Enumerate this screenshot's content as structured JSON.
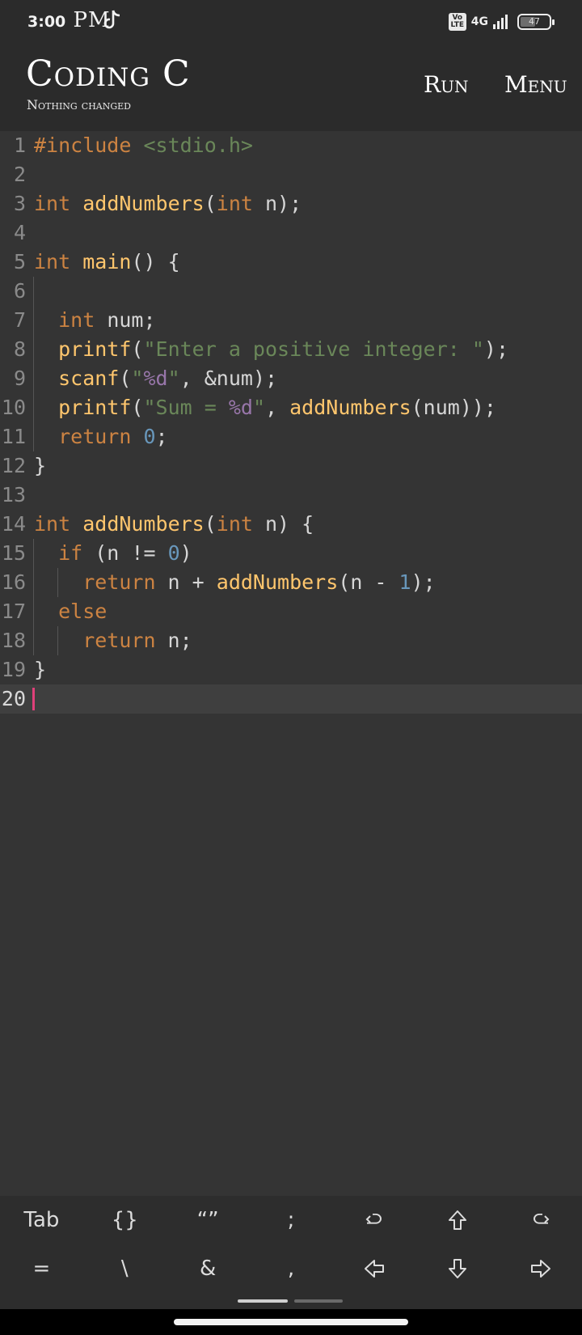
{
  "status_bar": {
    "time": "3:00",
    "ampm": "PM",
    "volte": "Vo LTE",
    "network": "4G",
    "battery": "47"
  },
  "app_bar": {
    "title": "Coding C",
    "subtitle": "Nothing changed",
    "run_label": "Run",
    "menu_label": "Menu"
  },
  "editor": {
    "active_line": 20,
    "lines": [
      {
        "n": "1",
        "indent": 0,
        "tokens": [
          [
            "kw",
            "#include "
          ],
          [
            "str",
            "<stdio.h>"
          ]
        ]
      },
      {
        "n": "2",
        "indent": 0,
        "tokens": []
      },
      {
        "n": "3",
        "indent": 0,
        "tokens": [
          [
            "kw",
            "int "
          ],
          [
            "fn",
            "addNumbers"
          ],
          [
            "p",
            "("
          ],
          [
            "kw",
            "int"
          ],
          [
            "p",
            " n);"
          ]
        ]
      },
      {
        "n": "4",
        "indent": 0,
        "tokens": []
      },
      {
        "n": "5",
        "indent": 0,
        "tokens": [
          [
            "kw",
            "int "
          ],
          [
            "fn",
            "main"
          ],
          [
            "p",
            "() {"
          ]
        ]
      },
      {
        "n": "6",
        "indent": 0,
        "guides": [
          1
        ],
        "tokens": []
      },
      {
        "n": "7",
        "indent": 1,
        "guides": [
          1
        ],
        "tokens": [
          [
            "kw",
            "int "
          ],
          [
            "p",
            "num;"
          ]
        ]
      },
      {
        "n": "8",
        "indent": 1,
        "guides": [
          1
        ],
        "tokens": [
          [
            "fn",
            "printf"
          ],
          [
            "p",
            "("
          ],
          [
            "str",
            "\"Enter a positive integer: \""
          ],
          [
            "p",
            ");"
          ]
        ]
      },
      {
        "n": "9",
        "indent": 1,
        "guides": [
          1
        ],
        "tokens": [
          [
            "fn",
            "scanf"
          ],
          [
            "p",
            "("
          ],
          [
            "str",
            "\""
          ],
          [
            "fmt",
            "%d"
          ],
          [
            "str",
            "\""
          ],
          [
            "p",
            ", &num);"
          ]
        ]
      },
      {
        "n": "10",
        "indent": 1,
        "guides": [
          1
        ],
        "tokens": [
          [
            "fn",
            "printf"
          ],
          [
            "p",
            "("
          ],
          [
            "str",
            "\"Sum = "
          ],
          [
            "fmt",
            "%d"
          ],
          [
            "str",
            "\""
          ],
          [
            "p",
            ", "
          ],
          [
            "fn",
            "addNumbers"
          ],
          [
            "p",
            "(num));"
          ]
        ]
      },
      {
        "n": "11",
        "indent": 1,
        "guides": [
          1
        ],
        "tokens": [
          [
            "kw",
            "return "
          ],
          [
            "num",
            "0"
          ],
          [
            "p",
            ";"
          ]
        ]
      },
      {
        "n": "12",
        "indent": 0,
        "tokens": [
          [
            "p",
            "}"
          ]
        ]
      },
      {
        "n": "13",
        "indent": 0,
        "tokens": []
      },
      {
        "n": "14",
        "indent": 0,
        "tokens": [
          [
            "kw",
            "int "
          ],
          [
            "fn",
            "addNumbers"
          ],
          [
            "p",
            "("
          ],
          [
            "kw",
            "int"
          ],
          [
            "p",
            " n) {"
          ]
        ]
      },
      {
        "n": "15",
        "indent": 1,
        "guides": [
          1
        ],
        "tokens": [
          [
            "kw",
            "if "
          ],
          [
            "p",
            "(n != "
          ],
          [
            "num",
            "0"
          ],
          [
            "p",
            ")"
          ]
        ]
      },
      {
        "n": "16",
        "indent": 2,
        "guides": [
          1,
          2
        ],
        "tokens": [
          [
            "kw",
            "return "
          ],
          [
            "p",
            "n + "
          ],
          [
            "fn",
            "addNumbers"
          ],
          [
            "p",
            "(n - "
          ],
          [
            "num",
            "1"
          ],
          [
            "p",
            ");"
          ]
        ]
      },
      {
        "n": "17",
        "indent": 1,
        "guides": [
          1
        ],
        "tokens": [
          [
            "kw",
            "else"
          ]
        ]
      },
      {
        "n": "18",
        "indent": 2,
        "guides": [
          1,
          2
        ],
        "tokens": [
          [
            "kw",
            "return "
          ],
          [
            "p",
            "n;"
          ]
        ]
      },
      {
        "n": "19",
        "indent": 0,
        "tokens": [
          [
            "p",
            "}"
          ]
        ]
      },
      {
        "n": "20",
        "indent": 0,
        "tokens": []
      }
    ]
  },
  "keys": {
    "row1": [
      {
        "name": "tab-key",
        "label": "Tab"
      },
      {
        "name": "braces-key",
        "label": "{}"
      },
      {
        "name": "quotes-key",
        "label": "“”"
      },
      {
        "name": "semicolon-key",
        "label": ";"
      },
      {
        "name": "undo-key",
        "icon": "undo-icon"
      },
      {
        "name": "shift-key",
        "icon": "shift-up-icon"
      },
      {
        "name": "redo-key",
        "icon": "redo-icon"
      }
    ],
    "row2": [
      {
        "name": "equals-key",
        "label": "="
      },
      {
        "name": "backslash-key",
        "label": "\\"
      },
      {
        "name": "ampersand-key",
        "label": "&"
      },
      {
        "name": "comma-key",
        "label": ","
      },
      {
        "name": "arrow-left-key",
        "icon": "arrow-left-icon"
      },
      {
        "name": "arrow-down-key",
        "icon": "arrow-down-icon"
      },
      {
        "name": "arrow-right-key",
        "icon": "arrow-right-icon"
      }
    ]
  },
  "colors": {
    "keyword": "#cc8342",
    "function": "#ffc66d",
    "string": "#6a8759",
    "format": "#9876aa",
    "number": "#6897bb",
    "caret": "#e0407a"
  }
}
